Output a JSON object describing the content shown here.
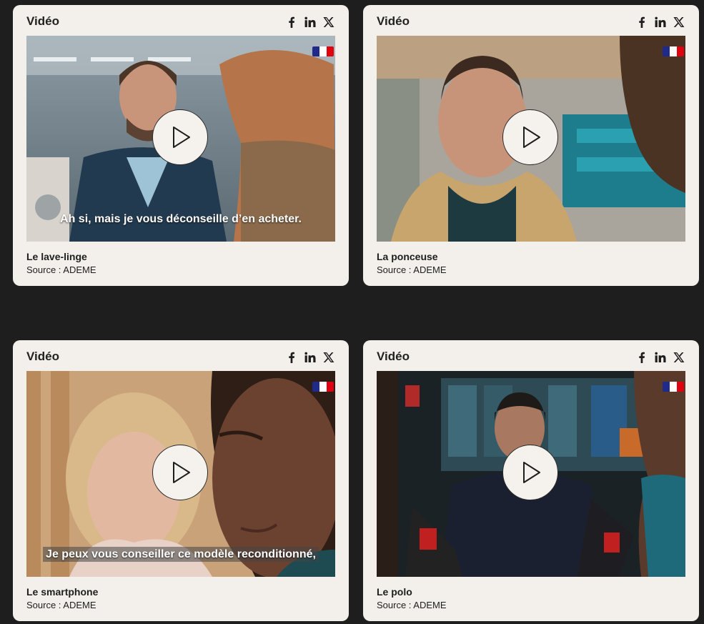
{
  "colors": {
    "page_background": "#1e1e1e",
    "card_background": "#f3efeb",
    "text": "#1e1e1e",
    "flag_blue": "#1f2a8a",
    "flag_red": "#e1000f"
  },
  "icons": {
    "share": [
      "facebook-icon",
      "linkedin-icon",
      "x-icon"
    ],
    "play": "play-icon",
    "badge": "french-republic-flag"
  },
  "cards": [
    {
      "label": "Vidéo",
      "title": "Le lave-linge",
      "source": "Source : ADEME",
      "subtitle": "Ah si, mais je vous déconseille d’en acheter."
    },
    {
      "label": "Vidéo",
      "title": "La ponceuse",
      "source": "Source : ADEME",
      "subtitle": ""
    },
    {
      "label": "Vidéo",
      "title": "Le smartphone",
      "source": "Source : ADEME",
      "subtitle": "Je peux vous conseiller ce modèle reconditionné,"
    },
    {
      "label": "Vidéo",
      "title": "Le polo",
      "source": "Source : ADEME",
      "subtitle": ""
    }
  ]
}
